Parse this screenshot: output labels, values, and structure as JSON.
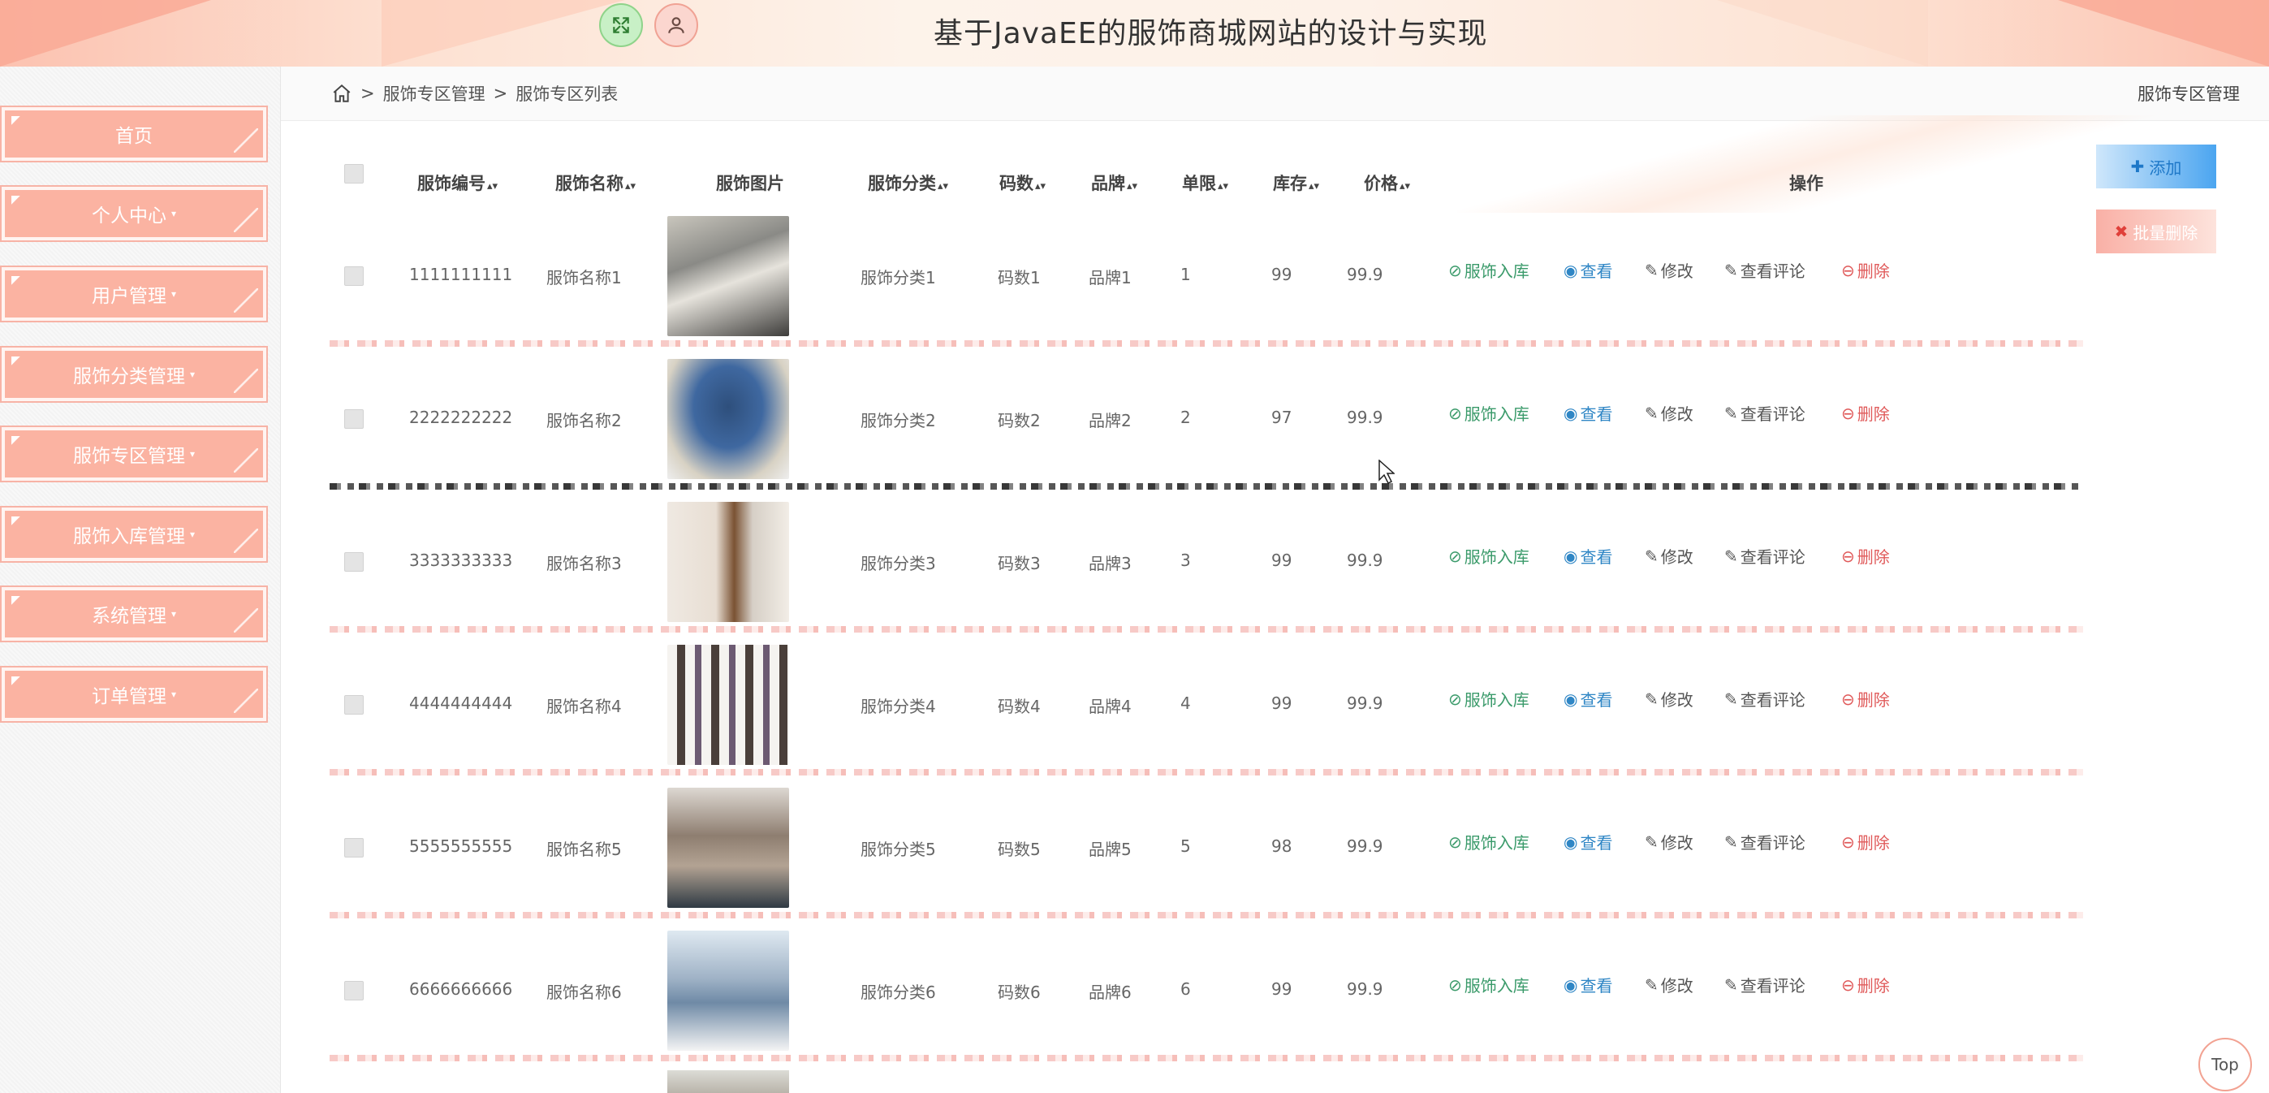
{
  "header": {
    "title": "基于JavaEE的服饰商城网站的设计与实现",
    "fullscreen_icon": "expand-icon",
    "user_icon": "user-icon"
  },
  "sidebar": {
    "items": [
      {
        "label": "首页",
        "has_caret": false
      },
      {
        "label": "个人中心",
        "has_caret": true
      },
      {
        "label": "用户管理",
        "has_caret": true
      },
      {
        "label": "服饰分类管理",
        "has_caret": true
      },
      {
        "label": "服饰专区管理",
        "has_caret": true
      },
      {
        "label": "服饰入库管理",
        "has_caret": true
      },
      {
        "label": "系统管理",
        "has_caret": true
      },
      {
        "label": "订单管理",
        "has_caret": true
      }
    ]
  },
  "breadcrumb": {
    "home_icon": "home-icon",
    "level1": "服饰专区管理",
    "level2": "服饰专区列表",
    "separator": ">"
  },
  "page_name": "服饰专区管理",
  "table": {
    "columns": [
      "服饰编号",
      "服饰名称",
      "服饰图片",
      "服饰分类",
      "码数",
      "品牌",
      "单限",
      "库存",
      "价格",
      "操作"
    ],
    "sortable": [
      true,
      true,
      false,
      true,
      true,
      true,
      true,
      true,
      true,
      false
    ],
    "actions": {
      "in": "服饰入库",
      "view": "查看",
      "edit": "修改",
      "comments": "查看评论",
      "delete": "删除"
    },
    "rows": [
      {
        "id": "1111111111",
        "name": "服饰名称1",
        "category": "服饰分类1",
        "size": "码数1",
        "brand": "品牌1",
        "limit": "1",
        "stock": "99",
        "price": "99.9"
      },
      {
        "id": "2222222222",
        "name": "服饰名称2",
        "category": "服饰分类2",
        "size": "码数2",
        "brand": "品牌2",
        "limit": "2",
        "stock": "97",
        "price": "99.9"
      },
      {
        "id": "3333333333",
        "name": "服饰名称3",
        "category": "服饰分类3",
        "size": "码数3",
        "brand": "品牌3",
        "limit": "3",
        "stock": "99",
        "price": "99.9"
      },
      {
        "id": "4444444444",
        "name": "服饰名称4",
        "category": "服饰分类4",
        "size": "码数4",
        "brand": "品牌4",
        "limit": "4",
        "stock": "99",
        "price": "99.9"
      },
      {
        "id": "5555555555",
        "name": "服饰名称5",
        "category": "服饰分类5",
        "size": "码数5",
        "brand": "品牌5",
        "limit": "5",
        "stock": "98",
        "price": "99.9"
      },
      {
        "id": "6666666666",
        "name": "服饰名称6",
        "category": "服饰分类6",
        "size": "码数6",
        "brand": "品牌6",
        "limit": "6",
        "stock": "99",
        "price": "99.9"
      }
    ]
  },
  "buttons": {
    "add": "添加",
    "batch_delete": "批量删除",
    "top": "Top"
  },
  "colors": {
    "accent": "#fbb3a2",
    "link": "#2f86c5",
    "success": "#3a9a6a",
    "danger": "#e05a5a"
  }
}
